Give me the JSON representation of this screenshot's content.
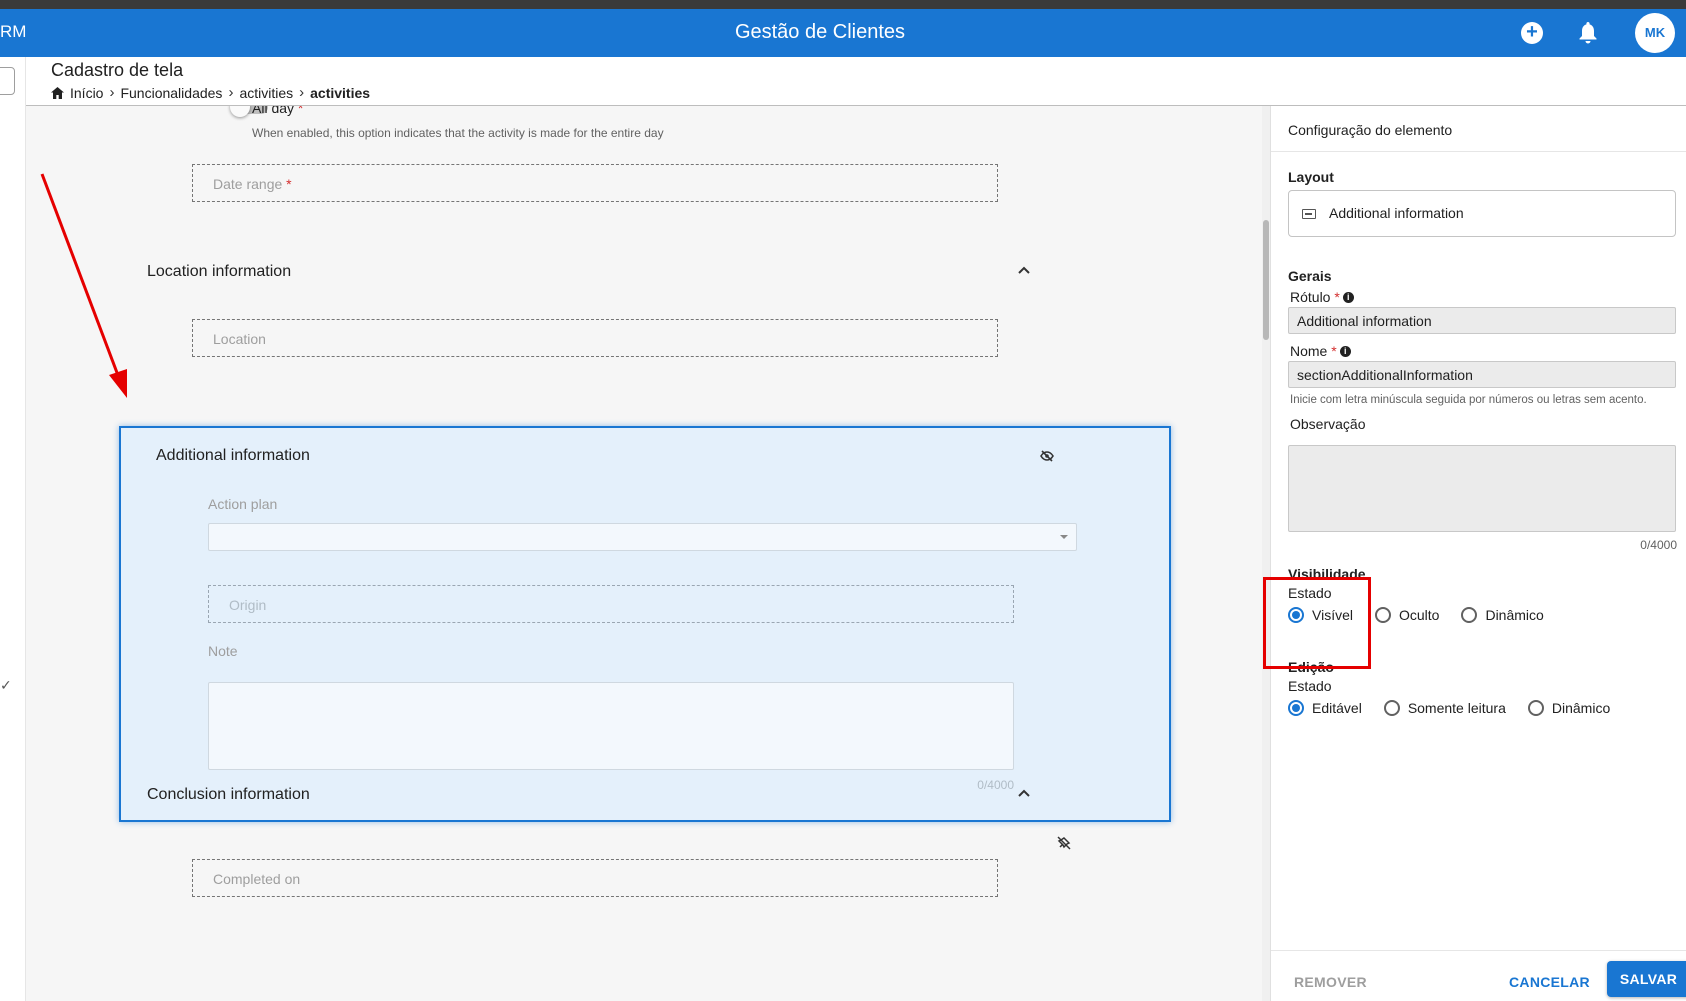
{
  "topbar": {
    "app_fragment": "RM",
    "title": "Gestão de Clientes",
    "avatar": "MK",
    "plus_symbol": "+",
    "icons": [
      "add-circle-icon",
      "bell-icon"
    ],
    "color": "#1976d2"
  },
  "header": {
    "page_title": "Cadastro de tela",
    "breadcrumbs": [
      "Início",
      "Funcionalidades",
      "activities",
      "activities"
    ]
  },
  "canvas": {
    "all_day_label": "All day",
    "all_day_required": "*",
    "all_day_hint": "When enabled, this option indicates that the activity is made for the entire day",
    "date_range_placeholder": "Date range",
    "date_range_required": "*",
    "location_section": "Location information",
    "location_placeholder": "Location",
    "additional_section": "Additional information",
    "action_plan_label": "Action plan",
    "origin_placeholder": "Origin",
    "note_label": "Note",
    "note_count": "0/4000",
    "conclusion_section": "Conclusion information",
    "completed_on_placeholder": "Completed on"
  },
  "panel": {
    "title": "Configuração do elemento",
    "layout_heading": "Layout",
    "layout_value": "Additional information",
    "gerais_heading": "Gerais",
    "rotulo_label": "Rótulo",
    "rotulo_value": "Additional information",
    "nome_label": "Nome",
    "nome_value": "sectionAdditionalInformation",
    "nome_hint": "Inicie com letra minúscula seguida por números ou letras sem acento.",
    "observacao_label": "Observação",
    "observacao_count": "0/4000",
    "required_mark": "*",
    "info_symbol": "i",
    "visibilidade_heading": "Visibilidade",
    "visibilidade_estado": "Estado",
    "visibilidade_options": [
      "Visível",
      "Oculto",
      "Dinâmico"
    ],
    "visibilidade_selected": "Visível",
    "edicao_heading": "Edição",
    "edicao_estado": "Estado",
    "edicao_options": [
      "Editável",
      "Somente leitura",
      "Dinâmico"
    ],
    "edicao_selected": "Editável",
    "remove_button": "REMOVER",
    "cancel_button": "CANCELAR",
    "save_button": "SALVAR"
  },
  "annotation": {
    "arrow_color": "#e50000",
    "highlight_box_color": "#e50000"
  }
}
